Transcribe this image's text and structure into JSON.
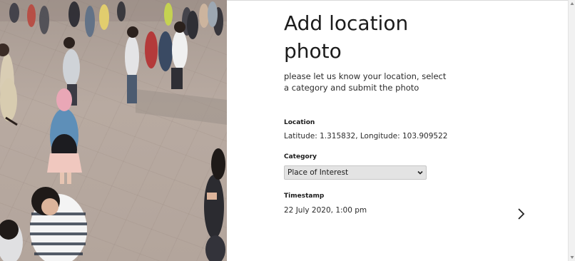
{
  "photo": {
    "icon": "crowd-photo"
  },
  "form": {
    "title": "Add location photo",
    "subtitle": "please let us know your location, select a category and submit the photo",
    "location": {
      "label": "Location",
      "value": "Latitude: 1.315832, Longitude: 103.909522"
    },
    "category": {
      "label": "Category",
      "selected": "Place of Interest"
    },
    "timestamp": {
      "label": "Timestamp",
      "value": "22 July 2020, 1:00 pm"
    },
    "next_icon": "chevron-right-icon"
  },
  "colors": {
    "text": "#1b1b1b",
    "select_bg": "#e3e3e3",
    "page_bg": "#ffffff"
  }
}
